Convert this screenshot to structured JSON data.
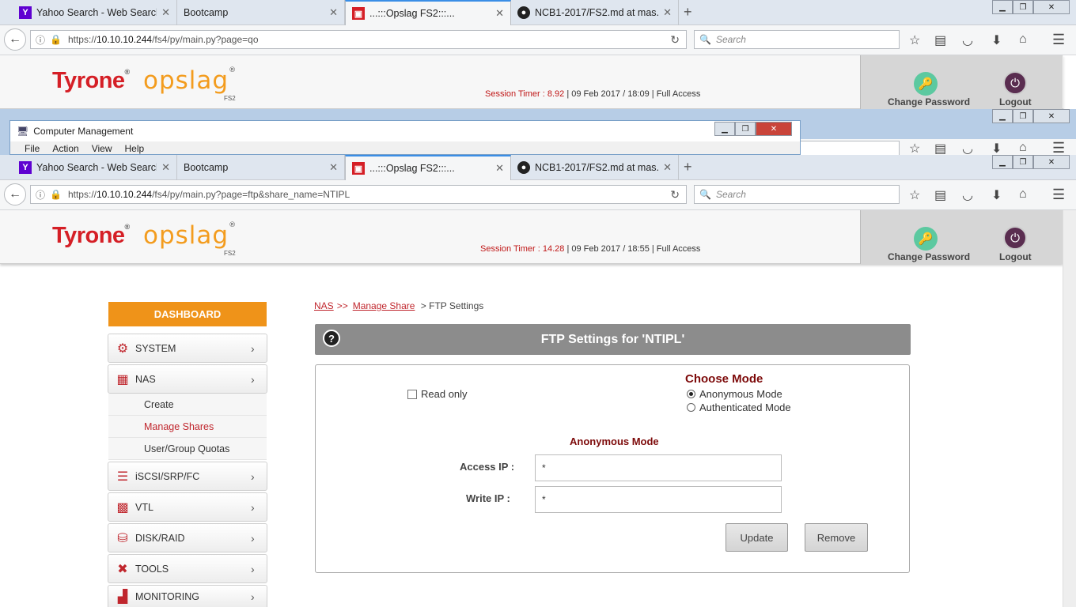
{
  "browser_top": {
    "tabs": [
      {
        "title": "Yahoo Search - Web Search",
        "icon": "yahoo-icon"
      },
      {
        "title": "Bootcamp",
        "icon": ""
      },
      {
        "title": "...:::Opslag FS2:::...",
        "icon": "opslag-icon"
      },
      {
        "title": "NCB1-2017/FS2.md at mas...",
        "icon": "github-icon"
      }
    ],
    "url_prefix": "https://",
    "url_host": "10.10.10.244",
    "url_path": "/fs4/py/main.py?page=qo",
    "search_placeholder": "Search"
  },
  "app_top": {
    "brand": "Tyrone",
    "product": "opslag",
    "product_sub": "FS2",
    "session_label": "Session Timer : ",
    "session_value": "8.92",
    "session_rest": " | 09 Feb 2017 / 18:09 | Full Access",
    "change_password": "Change Password",
    "logout": "Logout"
  },
  "computer_management": {
    "title": "Computer Management",
    "menu": [
      "File",
      "Action",
      "View",
      "Help"
    ]
  },
  "browser_main": {
    "tabs": [
      {
        "title": "Yahoo Search - Web Search",
        "icon": "yahoo-icon"
      },
      {
        "title": "Bootcamp",
        "icon": ""
      },
      {
        "title": "...:::Opslag FS2:::...",
        "icon": "opslag-icon"
      },
      {
        "title": "NCB1-2017/FS2.md at mas...",
        "icon": "github-icon"
      }
    ],
    "url_prefix": "https://",
    "url_host": "10.10.10.244",
    "url_path": "/fs4/py/main.py?page=ftp&share_name=NTIPL",
    "search_placeholder": "Search"
  },
  "app_main": {
    "brand": "Tyrone",
    "product": "opslag",
    "product_sub": "FS2",
    "session_label": "Session Timer : ",
    "session_value": "14.28",
    "session_rest": " | 09 Feb 2017 / 18:55 | Full Access",
    "change_password": "Change Password",
    "logout": "Logout"
  },
  "sidebar": {
    "dashboard": "DASHBOARD",
    "items": [
      {
        "label": "SYSTEM",
        "icon": "gear-icon"
      },
      {
        "label": "NAS",
        "icon": "nas-icon"
      },
      {
        "label": "iSCSI/SRP/FC",
        "icon": "server-icon"
      },
      {
        "label": "VTL",
        "icon": "vtl-icon"
      },
      {
        "label": "DISK/RAID",
        "icon": "disk-icon"
      },
      {
        "label": "TOOLS",
        "icon": "tools-icon"
      },
      {
        "label": "MONITORING",
        "icon": "chart-icon"
      }
    ],
    "nas_sub": [
      "Create",
      "Manage Shares",
      "User/Group Quotas"
    ]
  },
  "breadcrumb": {
    "nas": "NAS",
    "sep": ">>",
    "manage": "Manage Share",
    "current": "> FTP Settings"
  },
  "ftp": {
    "header": "FTP Settings for 'NTIPL'",
    "read_only": "Read only",
    "choose_mode": "Choose Mode",
    "anon_mode": "Anonymous Mode",
    "auth_mode": "Authenticated Mode",
    "section_title": "Anonymous Mode",
    "access_ip_label": "Access IP :",
    "access_ip_value": "*",
    "write_ip_label": "Write IP :",
    "write_ip_value": "*",
    "update": "Update",
    "remove": "Remove"
  }
}
